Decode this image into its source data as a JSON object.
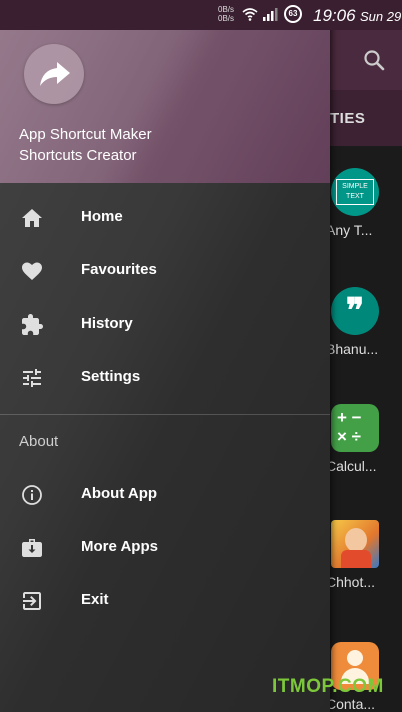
{
  "status_bar": {
    "net_up": "0B/s",
    "net_down": "0B/s",
    "battery_level": "63",
    "time": "19:06",
    "date": "Sun 29"
  },
  "background": {
    "tab_partial": "TIES",
    "items": [
      {
        "label": "Any T...",
        "icon": "simple-text-app-icon",
        "color": "#009688",
        "glyph": "SIMPLE TEXT"
      },
      {
        "label": "Bhanu...",
        "icon": "quote-app-icon",
        "color": "#00897b",
        "glyph": "❞"
      },
      {
        "label": "Calcul...",
        "icon": "calculator-app-icon",
        "color": "#4caf50",
        "glyph": "+−×÷"
      },
      {
        "label": "Chhot...",
        "icon": "cartoon-app-icon",
        "color": "#f5a623",
        "glyph": ""
      },
      {
        "label": "Conta...",
        "icon": "contacts-app-icon",
        "color": "#ef8c3c",
        "glyph": ""
      }
    ]
  },
  "drawer": {
    "title_line1": "App Shortcut Maker",
    "title_line2": "Shortcuts Creator",
    "menu": [
      {
        "label": "Home",
        "icon": "home-icon"
      },
      {
        "label": "Favourites",
        "icon": "heart-icon"
      },
      {
        "label": "History",
        "icon": "puzzle-icon"
      },
      {
        "label": "Settings",
        "icon": "sliders-icon"
      }
    ],
    "section": "About",
    "about_menu": [
      {
        "label": "About App",
        "icon": "info-icon"
      },
      {
        "label": "More Apps",
        "icon": "briefcase-download-icon"
      },
      {
        "label": "Exit",
        "icon": "exit-icon"
      }
    ]
  },
  "watermark": "ITMOP.COM"
}
